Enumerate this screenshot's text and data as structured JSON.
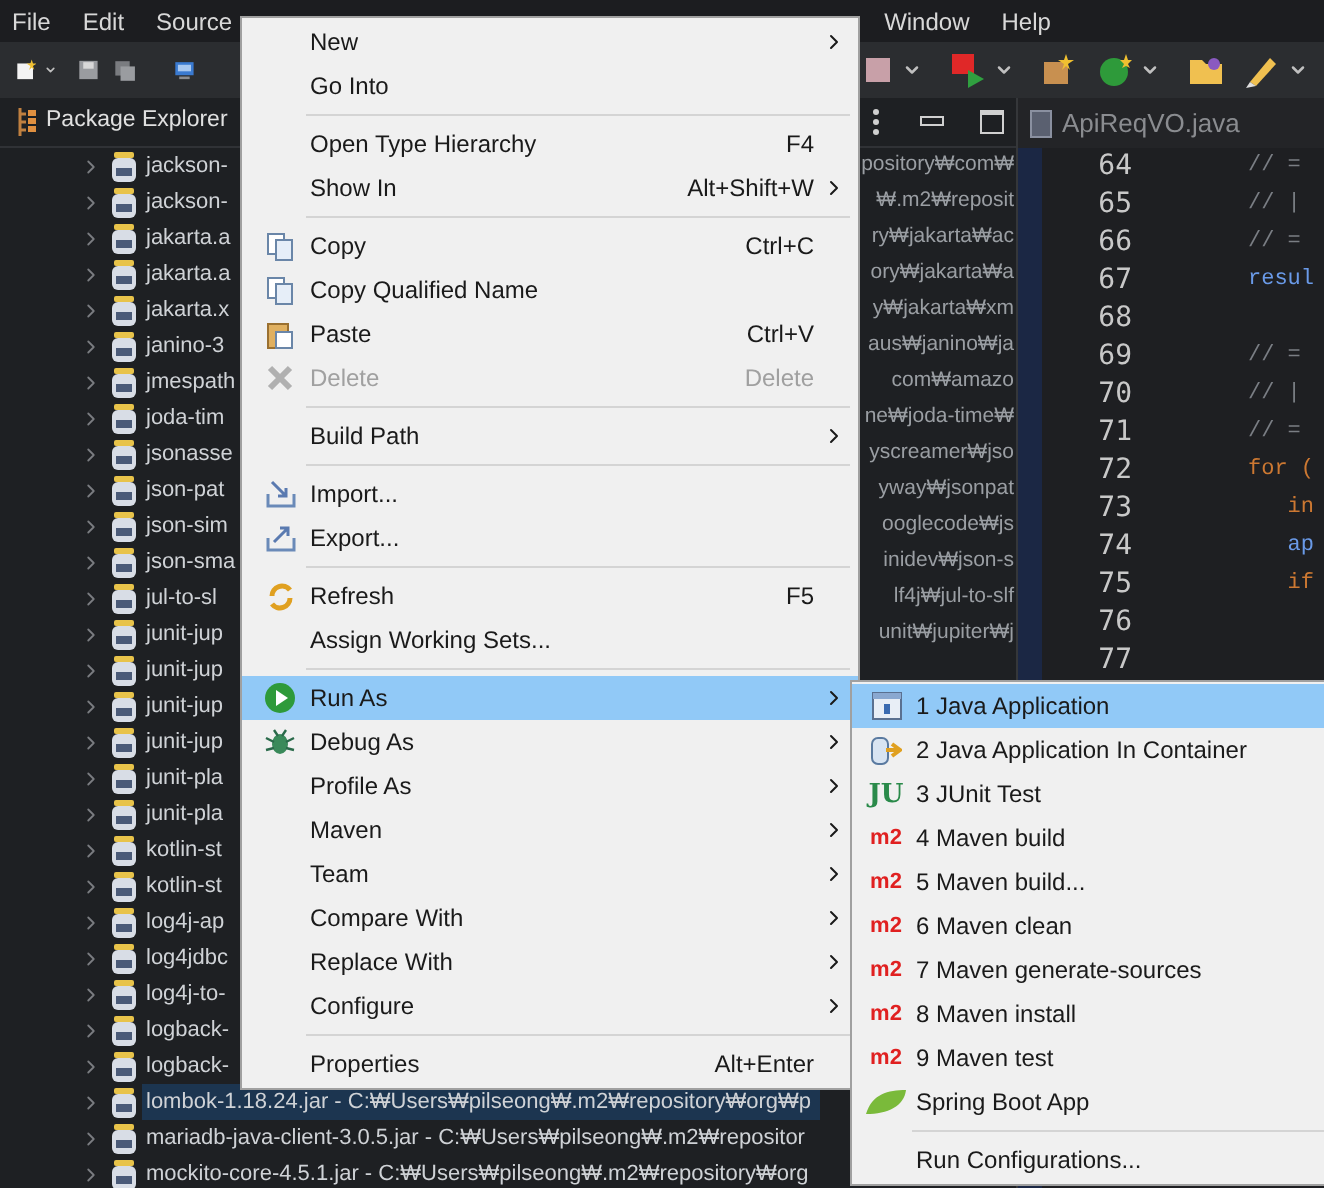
{
  "menubar": [
    "File",
    "Edit",
    "Source",
    "Window",
    "Help"
  ],
  "package_explorer": {
    "title": "Package Explorer",
    "rows": [
      {
        "name": "jackson-",
        "path": "pository₩com₩",
        "selected": false
      },
      {
        "name": "jackson-",
        "path": "₩.m2₩reposit",
        "selected": false
      },
      {
        "name": "jakarta.a",
        "path": "ry₩jakarta₩ac",
        "selected": false
      },
      {
        "name": "jakarta.a",
        "path": "ory₩jakarta₩a",
        "selected": false
      },
      {
        "name": "jakarta.x",
        "path": "y₩jakarta₩xm",
        "selected": false
      },
      {
        "name": "janino-3",
        "path": "aus₩janino₩ja",
        "selected": false
      },
      {
        "name": "jmespath",
        "path": "com₩amazo",
        "selected": false
      },
      {
        "name": "joda-tim",
        "path": "ne₩joda-time₩",
        "selected": false
      },
      {
        "name": "jsonasse",
        "path": "yscreamer₩jso",
        "selected": false
      },
      {
        "name": "json-pat",
        "path": "yway₩jsonpat",
        "selected": false
      },
      {
        "name": "json-sim",
        "path": "ooglecode₩js",
        "selected": false
      },
      {
        "name": "json-sma",
        "path": "inidev₩json-s",
        "selected": false
      },
      {
        "name": "jul-to-sl",
        "path": "lf4j₩jul-to-slf",
        "selected": false
      },
      {
        "name": "junit-jup",
        "path": "unit₩jupiter₩j",
        "selected": false
      },
      {
        "name": "junit-jup",
        "selected": false
      },
      {
        "name": "junit-jup",
        "selected": false
      },
      {
        "name": "junit-jup",
        "selected": false
      },
      {
        "name": "junit-pla",
        "selected": false
      },
      {
        "name": "junit-pla",
        "selected": false
      },
      {
        "name": "kotlin-st",
        "selected": false
      },
      {
        "name": "kotlin-st",
        "selected": false
      },
      {
        "name": "log4j-ap",
        "selected": false
      },
      {
        "name": "log4jdbc",
        "selected": false
      },
      {
        "name": "log4j-to-",
        "selected": false
      },
      {
        "name": "logback-",
        "selected": false
      },
      {
        "name": "logback-",
        "selected": false
      },
      {
        "name": "lombok-1.18.24.jar - C:₩Users₩pilseong₩.m2₩repository₩org₩p",
        "selected": true
      },
      {
        "name": "mariadb-java-client-3.0.5.jar - C:₩Users₩pilseong₩.m2₩repositor",
        "selected": false
      },
      {
        "name": "mockito-core-4.5.1.jar - C:₩Users₩pilseong₩.m2₩repository₩org",
        "selected": false
      }
    ]
  },
  "editor": {
    "tab": "ApiReqVO.java",
    "lines": [
      {
        "number": "64",
        "code": "// =",
        "kind": "comment"
      },
      {
        "number": "65",
        "code": "// |",
        "kind": "comment"
      },
      {
        "number": "66",
        "code": "// =",
        "kind": "comment"
      },
      {
        "number": "67",
        "code": "resul",
        "kind": "field"
      },
      {
        "number": "68"
      },
      {
        "number": "69",
        "code": "// =",
        "kind": "comment"
      },
      {
        "number": "70",
        "code": "// |",
        "kind": "comment"
      },
      {
        "number": "71",
        "code": "// =",
        "kind": "comment"
      },
      {
        "number": "72",
        "code": "for (",
        "kind": "keyword"
      },
      {
        "number": "73",
        "code": "   in",
        "kind": "keyword"
      },
      {
        "number": "74",
        "code": "   ap",
        "kind": "field"
      },
      {
        "number": "75",
        "code": "   if",
        "kind": "keyword"
      },
      {
        "number": "76"
      },
      {
        "number": "77"
      }
    ]
  },
  "context_menu": [
    {
      "kind": "item",
      "label": "New",
      "submenu": true,
      "selected": false,
      "disabled": false
    },
    {
      "kind": "item",
      "label": "Go Into",
      "submenu": false,
      "selected": false,
      "disabled": false
    },
    {
      "kind": "separator"
    },
    {
      "kind": "item",
      "label": "Open Type Hierarchy",
      "shortcut": "F4",
      "submenu": false,
      "selected": false,
      "disabled": false
    },
    {
      "kind": "item",
      "label": "Show In",
      "shortcut": "Alt+Shift+W",
      "submenu": true,
      "selected": false,
      "disabled": false
    },
    {
      "kind": "separator"
    },
    {
      "kind": "item",
      "label": "Copy",
      "shortcut": "Ctrl+C",
      "submenu": false,
      "selected": false,
      "disabled": false
    },
    {
      "kind": "item",
      "label": "Copy Qualified Name",
      "submenu": false,
      "selected": false,
      "disabled": false
    },
    {
      "kind": "item",
      "label": "Paste",
      "shortcut": "Ctrl+V",
      "submenu": false,
      "selected": false,
      "disabled": false
    },
    {
      "kind": "item",
      "label": "Delete",
      "shortcut": "Delete",
      "submenu": false,
      "selected": false,
      "disabled": true
    },
    {
      "kind": "separator"
    },
    {
      "kind": "item",
      "label": "Build Path",
      "submenu": true,
      "selected": false,
      "disabled": false
    },
    {
      "kind": "separator"
    },
    {
      "kind": "item",
      "label": "Import...",
      "submenu": false,
      "selected": false,
      "disabled": false
    },
    {
      "kind": "item",
      "label": "Export...",
      "submenu": false,
      "selected": false,
      "disabled": false
    },
    {
      "kind": "separator"
    },
    {
      "kind": "item",
      "label": "Refresh",
      "shortcut": "F5",
      "submenu": false,
      "selected": false,
      "disabled": false
    },
    {
      "kind": "item",
      "label": "Assign Working Sets...",
      "submenu": false,
      "selected": false,
      "disabled": false
    },
    {
      "kind": "separator"
    },
    {
      "kind": "item",
      "label": "Run As",
      "submenu": true,
      "selected": true,
      "disabled": false
    },
    {
      "kind": "item",
      "label": "Debug As",
      "submenu": true,
      "selected": false,
      "disabled": false
    },
    {
      "kind": "item",
      "label": "Profile As",
      "submenu": true,
      "selected": false,
      "disabled": false
    },
    {
      "kind": "item",
      "label": "Maven",
      "submenu": true,
      "selected": false,
      "disabled": false
    },
    {
      "kind": "item",
      "label": "Team",
      "submenu": true,
      "selected": false,
      "disabled": false
    },
    {
      "kind": "item",
      "label": "Compare With",
      "submenu": true,
      "selected": false,
      "disabled": false
    },
    {
      "kind": "item",
      "label": "Replace With",
      "submenu": true,
      "selected": false,
      "disabled": false
    },
    {
      "kind": "item",
      "label": "Configure",
      "submenu": true,
      "selected": false,
      "disabled": false
    },
    {
      "kind": "separator"
    },
    {
      "kind": "item",
      "label": "Properties",
      "shortcut": "Alt+Enter",
      "submenu": false,
      "selected": false,
      "disabled": false
    }
  ],
  "run_as_submenu": [
    {
      "kind": "item",
      "label": "1 Java Application",
      "selected": true
    },
    {
      "kind": "item",
      "label": "2 Java Application In Container",
      "selected": false
    },
    {
      "kind": "item",
      "label": "3 JUnit Test",
      "logo": "JU",
      "selected": false
    },
    {
      "kind": "item",
      "label": "4 Maven build",
      "logo": "m2",
      "selected": false
    },
    {
      "kind": "item",
      "label": "5 Maven build...",
      "logo": "m2",
      "selected": false
    },
    {
      "kind": "item",
      "label": "6 Maven clean",
      "logo": "m2",
      "selected": false
    },
    {
      "kind": "item",
      "label": "7 Maven generate-sources",
      "logo": "m2",
      "selected": false
    },
    {
      "kind": "item",
      "label": "8 Maven install",
      "logo": "m2",
      "selected": false
    },
    {
      "kind": "item",
      "label": "9 Maven test",
      "logo": "m2",
      "selected": false
    },
    {
      "kind": "item",
      "label": "Spring Boot App",
      "selected": false
    },
    {
      "kind": "separator"
    },
    {
      "kind": "item",
      "label": "Run Configurations...",
      "selected": false
    }
  ]
}
